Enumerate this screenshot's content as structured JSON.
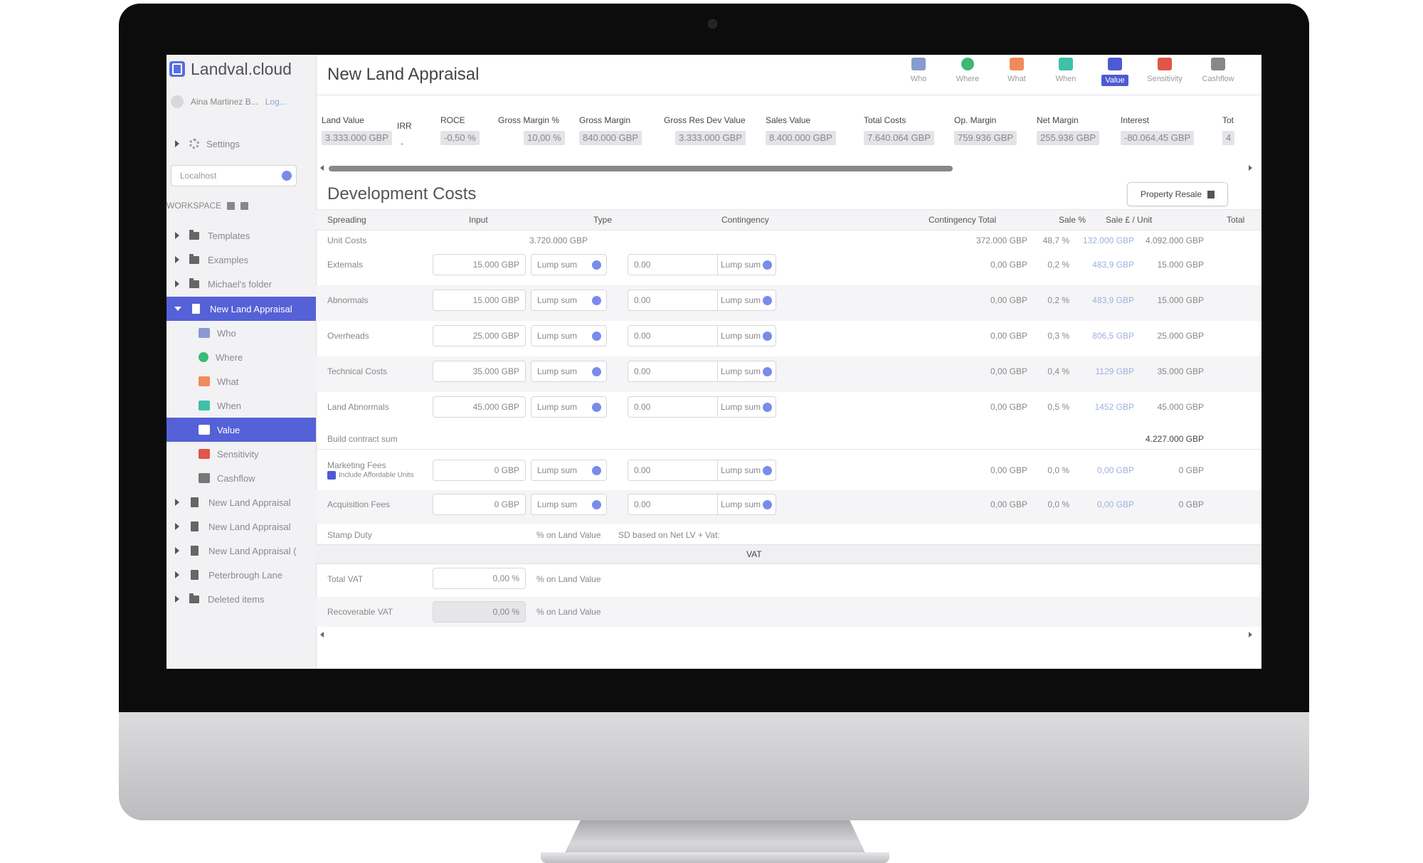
{
  "app": {
    "name": "Landval.cloud",
    "user": "Aina Martinez B...",
    "logout": "Log..."
  },
  "sidebar": {
    "settings_label": "Settings",
    "search_placeholder": "Localhost",
    "workspace_label": "WORKSPACE",
    "items": [
      {
        "label": "Templates",
        "type": "folder"
      },
      {
        "label": "Examples",
        "type": "folder"
      },
      {
        "label": "Michael's folder",
        "type": "folder"
      },
      {
        "label": "New Land Appraisal",
        "type": "doc",
        "active": true
      }
    ],
    "subitems": [
      {
        "label": "Who",
        "icon": "people-icon",
        "color": "#8a9ad0"
      },
      {
        "label": "Where",
        "icon": "location-icon",
        "color": "#3cb878"
      },
      {
        "label": "What",
        "icon": "house-icon",
        "color": "#f08a5d"
      },
      {
        "label": "When",
        "icon": "calendar-icon",
        "color": "#3ec1a8"
      },
      {
        "label": "Value",
        "icon": "money-icon",
        "color": "#ffffff",
        "active": true
      },
      {
        "label": "Sensitivity",
        "icon": "sensitivity-icon",
        "color": "#e0564a"
      },
      {
        "label": "Cashflow",
        "icon": "cashflow-icon",
        "color": "#777777"
      }
    ],
    "more_items": [
      {
        "label": "New Land Appraisal",
        "type": "doc"
      },
      {
        "label": "New Land Appraisal",
        "type": "doc"
      },
      {
        "label": "New Land Appraisal (",
        "type": "doc"
      },
      {
        "label": "Peterbrough Lane",
        "type": "doc"
      },
      {
        "label": "Deleted items",
        "type": "folder"
      }
    ]
  },
  "header": {
    "title": "New Land Appraisal",
    "tabs": [
      {
        "label": "Who",
        "icon": "people-icon",
        "color": "#8a9ad0"
      },
      {
        "label": "Where",
        "icon": "location-icon",
        "color": "#3cb878"
      },
      {
        "label": "What",
        "icon": "house-icon",
        "color": "#f08a5d"
      },
      {
        "label": "When",
        "icon": "calendar-icon",
        "color": "#3ec1a8"
      },
      {
        "label": "Value",
        "icon": "money-icon",
        "color": "#4d5ad4",
        "active": true
      },
      {
        "label": "Sensitivity",
        "icon": "sensitivity-icon",
        "color": "#e0564a"
      },
      {
        "label": "Cashflow",
        "icon": "cashflow-icon",
        "color": "#888888"
      }
    ]
  },
  "kpis": [
    {
      "label": "Land Value",
      "value": "3.333.000 GBP"
    },
    {
      "label": "IRR",
      "value": "-"
    },
    {
      "label": "ROCE",
      "value": "-0,50 %"
    },
    {
      "label": "Gross Margin %",
      "value": "10,00 %"
    },
    {
      "label": "Gross Margin",
      "value": "840.000 GBP"
    },
    {
      "label": "Gross Res Dev Value",
      "value": "3.333.000 GBP"
    },
    {
      "label": "Sales Value",
      "value": "8.400.000 GBP"
    },
    {
      "label": "Total Costs",
      "value": "7.640.064 GBP"
    },
    {
      "label": "Op. Margin",
      "value": "759.936 GBP"
    },
    {
      "label": "Net Margin",
      "value": "255.936 GBP"
    },
    {
      "label": "Interest",
      "value": "-80.064,45 GBP"
    },
    {
      "label": "Tot",
      "value": "4"
    }
  ],
  "section": {
    "title": "Development Costs",
    "property_button": "Property Resale"
  },
  "table": {
    "headers": [
      "Spreading",
      "Input",
      "Type",
      "Contingency",
      "Contingency Total",
      "Sale %",
      "Sale £ / Unit",
      "Total"
    ],
    "unit_costs": {
      "label": "Unit Costs",
      "input": "3.720.000 GBP",
      "contingency_total": "372.000 GBP",
      "sale_pct": "48,7 %",
      "sale_unit": "132.000 GBP",
      "total": "4.092.000 GBP"
    },
    "rows": [
      {
        "label": "Externals",
        "input": "15.000 GBP",
        "type": "Lump sum",
        "contingency": "0.00",
        "ctype": "Lump sum",
        "contingency_total": "0,00 GBP",
        "sale_pct": "0,2 %",
        "sale_unit": "483,9 GBP",
        "total": "15.000 GBP"
      },
      {
        "label": "Abnormals",
        "input": "15.000 GBP",
        "type": "Lump sum",
        "contingency": "0.00",
        "ctype": "Lump sum",
        "contingency_total": "0,00 GBP",
        "sale_pct": "0,2 %",
        "sale_unit": "483,9 GBP",
        "total": "15.000 GBP"
      },
      {
        "label": "Overheads",
        "input": "25.000 GBP",
        "type": "Lump sum",
        "contingency": "0.00",
        "ctype": "Lump sum",
        "contingency_total": "0,00 GBP",
        "sale_pct": "0,3 %",
        "sale_unit": "806,5 GBP",
        "total": "25.000 GBP"
      },
      {
        "label": "Technical Costs",
        "input": "35.000 GBP",
        "type": "Lump sum",
        "contingency": "0.00",
        "ctype": "Lump sum",
        "contingency_total": "0,00 GBP",
        "sale_pct": "0,4 %",
        "sale_unit": "1129 GBP",
        "total": "35.000 GBP"
      },
      {
        "label": "Land Abnormals",
        "input": "45.000 GBP",
        "type": "Lump sum",
        "contingency": "0.00",
        "ctype": "Lump sum",
        "contingency_total": "0,00 GBP",
        "sale_pct": "0,5 %",
        "sale_unit": "1452 GBP",
        "total": "45.000 GBP"
      }
    ],
    "build_contract": {
      "label": "Build contract sum",
      "total": "4.227.000 GBP"
    },
    "fee_rows": [
      {
        "label": "Marketing Fees",
        "checkbox": "Include Affordable Units",
        "input": "0 GBP",
        "type": "Lump sum",
        "contingency": "0.00",
        "ctype": "Lump sum",
        "contingency_total": "0,00 GBP",
        "sale_pct": "0,0 %",
        "sale_unit": "0,00 GBP",
        "total": "0 GBP"
      },
      {
        "label": "Acquisition Fees",
        "input": "0 GBP",
        "type": "Lump sum",
        "contingency": "0.00",
        "ctype": "Lump sum",
        "contingency_total": "0,00 GBP",
        "sale_pct": "0,0 %",
        "sale_unit": "0,00 GBP",
        "total": "0 GBP"
      }
    ],
    "stamp_duty": {
      "label": "Stamp Duty",
      "type": "% on Land Value",
      "note": "SD based on Net LV + Vat:"
    },
    "vat_heading": "VAT",
    "vat_rows": [
      {
        "label": "Total VAT",
        "input": "0,00 %",
        "type": "% on Land Value"
      },
      {
        "label": "Recoverable VAT",
        "input": "0,00 %",
        "type": "% on Land Value"
      }
    ]
  }
}
